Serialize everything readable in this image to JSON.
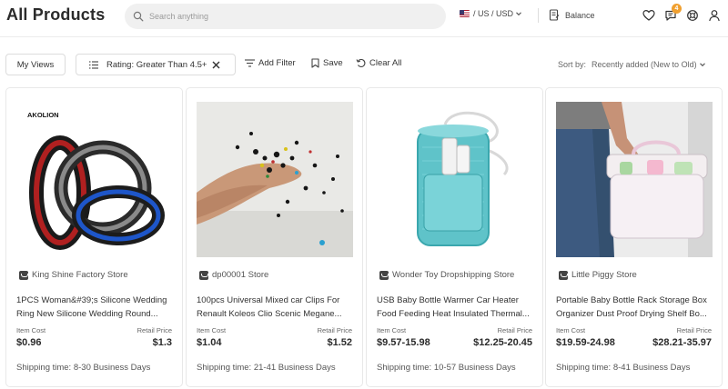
{
  "header": {
    "title": "All Products",
    "search_placeholder": "Search anything",
    "locale": "/ US / USD",
    "balance_label": "Balance",
    "notifications_count": "4"
  },
  "toolbar": {
    "my_views": "My Views",
    "filter_chip": "Rating: Greater Than 4.5+",
    "add_filter": "Add Filter",
    "save": "Save",
    "clear_all": "Clear All",
    "sort_label": "Sort by:",
    "sort_value": "Recently added (New to Old)"
  },
  "labels": {
    "item_cost": "Item Cost",
    "retail_price": "Retail Price"
  },
  "products": [
    {
      "image": "silicone-rings-photo",
      "store": "King Shine Factory Store",
      "title": "1PCS Woman&#39;s Silicone Wedding Ring New Silicone Wedding Round...",
      "item_cost": "$0.96",
      "retail_price": "$1.3",
      "shipping": "Shipping time: 8-30 Business Days"
    },
    {
      "image": "car-clips-photo",
      "store": "dp00001 Store",
      "title": "100pcs Universal Mixed car Clips For Renault Koleos Clio Scenic Megane...",
      "item_cost": "$1.04",
      "retail_price": "$1.52",
      "shipping": "Shipping time: 21-41 Business Days"
    },
    {
      "image": "bottle-warmer-photo",
      "store": "Wonder Toy Dropshipping Store",
      "title": "USB Baby Bottle Warmer Car Heater Food Feeding Heat Insulated Thermal...",
      "item_cost": "$9.57-15.98",
      "retail_price": "$12.25-20.45",
      "shipping": "Shipping time: 10-57 Business Days"
    },
    {
      "image": "bottle-rack-box-photo",
      "store": "Little Piggy Store",
      "title": "Portable Baby Bottle Rack Storage Box Organizer Dust Proof Drying Shelf Bo...",
      "item_cost": "$19.59-24.98",
      "retail_price": "$28.21-35.97",
      "shipping": "Shipping time: 8-41 Business Days"
    }
  ]
}
